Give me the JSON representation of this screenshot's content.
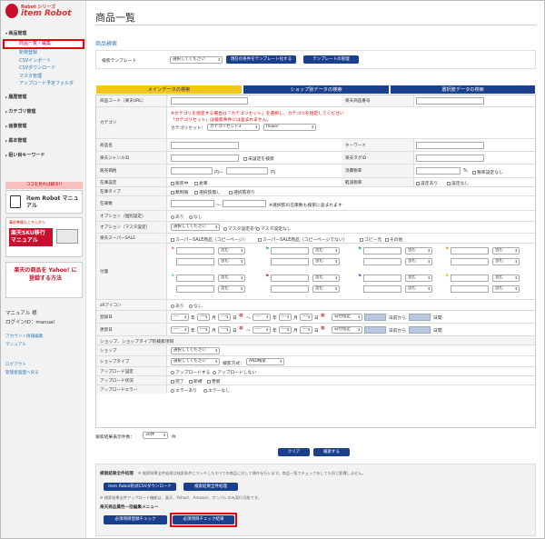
{
  "sidebar": {
    "logo_series": "Robot シリーズ",
    "logo_name": "item Robot",
    "items": [
      {
        "label": "商品管理",
        "open": true
      },
      {
        "label": "商品一覧・編集",
        "sub": true,
        "active": true
      },
      {
        "label": "新規登録",
        "sub": true
      },
      {
        "label": "CSVインポート",
        "sub": true
      },
      {
        "label": "CSVダウンロード",
        "sub": true
      },
      {
        "label": "マスタ管理",
        "sub": true
      },
      {
        "label": "アップロード予定フォルダ",
        "sub": true
      },
      {
        "label": "履歴管理"
      },
      {
        "label": "カテゴリ管理"
      },
      {
        "label": "画像管理"
      },
      {
        "label": "基本管理"
      },
      {
        "label": "狙い目キーワード"
      }
    ],
    "banner1_top": "ココを見れば解決!!",
    "banner1": "item Robot マニュアル",
    "banner2_top": "事前準備もこちらから",
    "banner2": "楽天SKU移行 マニュアル",
    "banner3": "楽天の商品を Yahoo! に登録する方法",
    "manual_user": "マニュアル 様",
    "login_id": "ログインID：manual",
    "links": [
      "アカウント情報編集",
      "マニュアル",
      "ログアウト",
      "管理者画面へ戻る"
    ]
  },
  "main": {
    "title": "商品一覧",
    "search_title": "商品検索",
    "template_label": "検索テンプレート",
    "template_select": "選択してください",
    "btn_save_tpl": "現在の条件をテンプレート化する",
    "btn_manage_tpl": "テンプレートの管理",
    "tabs": [
      "メインデータの検索",
      "ショップ別データの検索",
      "選択肢データの検索"
    ],
    "fields": {
      "code": "商品コード（楽天URL）",
      "rakuten_no": "楽天商品番号",
      "category": "カテゴリ",
      "cat_note1": "※カテゴリを指定する場合は「カテゴリセット」を選択し、カテゴリを指定してください",
      "cat_note2": "「カテゴリセット」は検索条件には含まれません。",
      "cat_set_label": "カテゴリセット：",
      "cat_set": "カテゴリセット3",
      "cat_value": "flower",
      "name": "商品名",
      "keyword": "キーワード",
      "genre": "楽天ジャンルID",
      "genre_chk": "未設定を検索",
      "tag": "楽天タグID",
      "price": "販売価格",
      "yen1": "円～",
      "yen2": "円",
      "tax": "消費税率",
      "pct": "%",
      "tax_chk": "税率設定なし",
      "stock": "在庫設定",
      "stock_opts": [
        "販売中",
        "倉庫"
      ],
      "tax_type": "軽減税率",
      "tax_type_opts": [
        "設定あり",
        "設定なし"
      ],
      "stock_type": "在庫タイプ",
      "stock_type_opts": [
        "無制限",
        "選択肢無し",
        "選択肢有り"
      ],
      "qty": "在庫数",
      "qty_note": "※選択肢の在庫数も検索に含まれます",
      "opt_indiv": "オプション（個別設定）",
      "opt_indiv_opts": [
        "あり",
        "なし"
      ],
      "opt_master": "オプション（マスタ設定）",
      "opt_master_sel": "選択してください",
      "opt_master_opts": [
        "マスタ設定あり",
        "マスタ設定なし"
      ],
      "super_sale": "楽天スーパーSALE",
      "super_sale_opts": [
        "スーパーSALE商品（コピーページ）",
        "スーパーSALE商品（コピーページでない）",
        "コピー元",
        "その他"
      ],
      "fuda": "付箋",
      "contains": "含む",
      "zr": "zRアイコン",
      "zr_opts": [
        "あり",
        "なし"
      ],
      "reg": "登録日",
      "upd": "更新日",
      "date_dash": "----",
      "year": "年",
      "month": "月",
      "day": "日",
      "tilde": "～",
      "date_spec": "日付指定",
      "from_day": "日前から",
      "days": "日間",
      "shop_section": "ショップ、ショップタイプ別検索項目",
      "shop": "ショップ",
      "shop_sel": "選択してください",
      "shop_type": "ショップタイプ",
      "shop_type_sel": "選択してください",
      "search_method": "検索方式：",
      "and": "AND検索",
      "upload_set": "アップロード設定",
      "upload_set_opts": [
        "アップロードする",
        "アップロードしない"
      ],
      "upload_status": "アップロード状況",
      "upload_status_opts": [
        "完了",
        "新規",
        "更新"
      ],
      "upload_err": "アップロードエラー",
      "upload_err_opts": [
        "エラーあり",
        "エラーなし"
      ]
    },
    "per_page_label": "検索結果表示件数：",
    "per_page": "30件",
    "per_page_unit": "件",
    "btn_clear": "クリア",
    "btn_search": "検索する",
    "bulk_title": "検索結果全件処理",
    "bulk_note": "※ 検索結果全件処理は検索条件にマッチしたすべての商品に対して操作を行います。商品一覧でチェックをしても同じ影響しません。",
    "btn_csv": "item Robot形式CSVダウンロード",
    "btn_bulk": "検索結果全件処理",
    "bulk_note2": "※ 検索結果全件アップロード機能は、楽天、Yahoo!、Amazon、ポンパレのみ実行可能です。",
    "req_title": "楽天商品属性一括編集メニュー",
    "btn_req_reg": "必須項目登録チェック",
    "btn_req_result": "必須項目チェック結果"
  }
}
